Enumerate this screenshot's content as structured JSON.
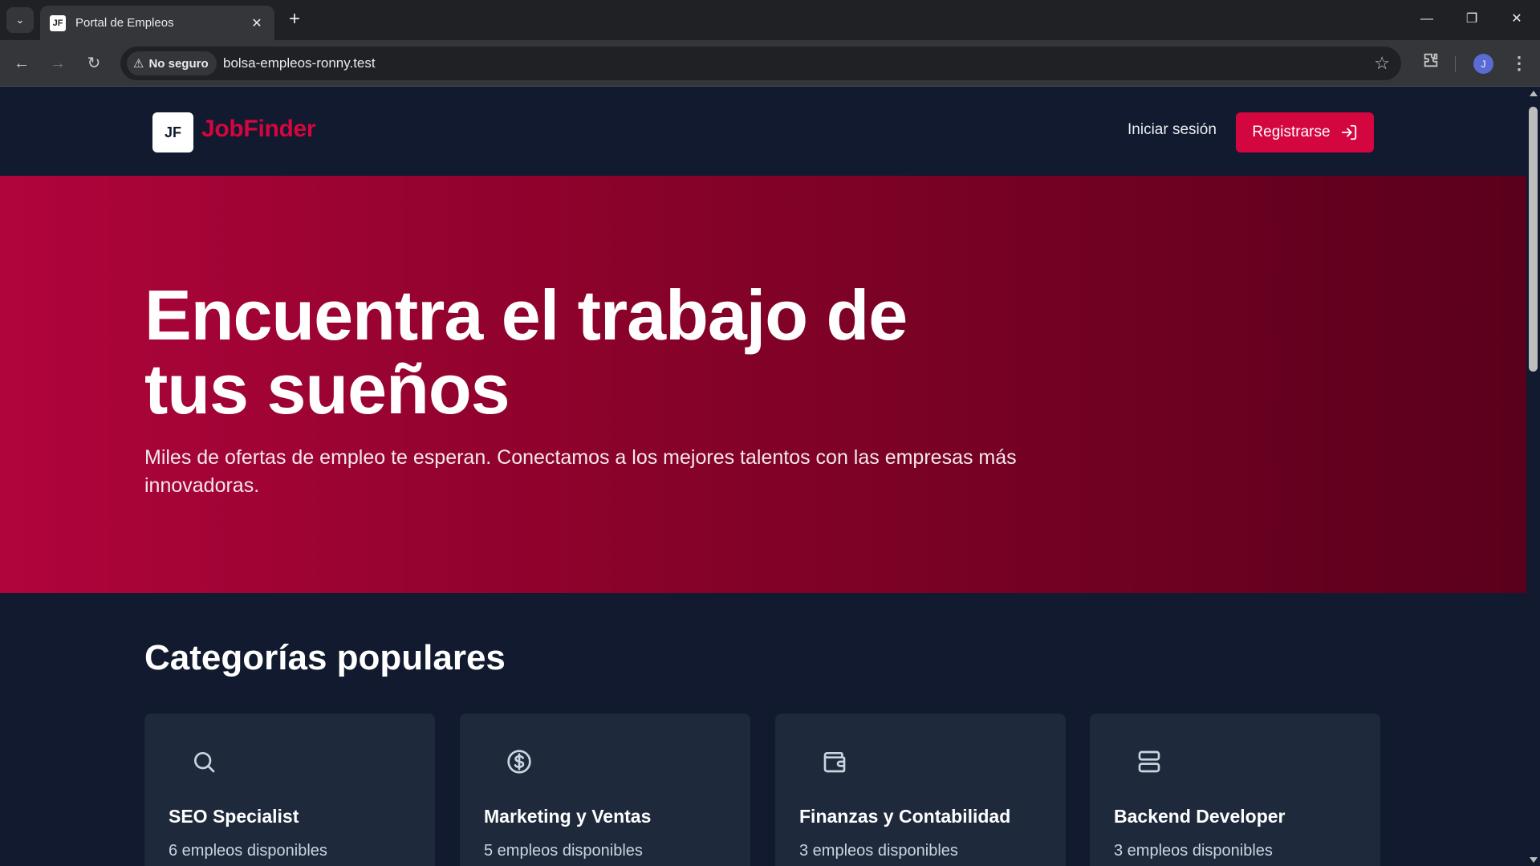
{
  "browser": {
    "tab_title": "Portal de Empleos",
    "tab_favicon": "JF",
    "security_label": "No seguro",
    "url": "bolsa-empleos-ronny.test",
    "profile_initial": "J"
  },
  "header": {
    "logo_mark": "JF",
    "brand": "JobFinder",
    "login": "Iniciar sesión",
    "register": "Registrarse"
  },
  "hero": {
    "title": "Encuentra el trabajo de tus sueños",
    "subtitle": "Miles de ofertas de empleo te esperan. Conectamos a los mejores talentos con las empresas más innovadoras."
  },
  "categories": {
    "title": "Categorías populares",
    "items": [
      {
        "icon": "search-icon",
        "name": "SEO Specialist",
        "count": "6 empleos disponibles"
      },
      {
        "icon": "dollar-icon",
        "name": "Marketing y Ventas",
        "count": "5 empleos disponibles"
      },
      {
        "icon": "wallet-icon",
        "name": "Finanzas y Contabilidad",
        "count": "3 empleos disponibles"
      },
      {
        "icon": "server-icon",
        "name": "Backend Developer",
        "count": "3 empleos disponibles"
      }
    ]
  },
  "colors": {
    "accent": "#d4063f",
    "page_bg": "#111a2e",
    "card_bg": "#1e293b",
    "hero_start": "#b0043c",
    "hero_end": "#5a001c"
  }
}
